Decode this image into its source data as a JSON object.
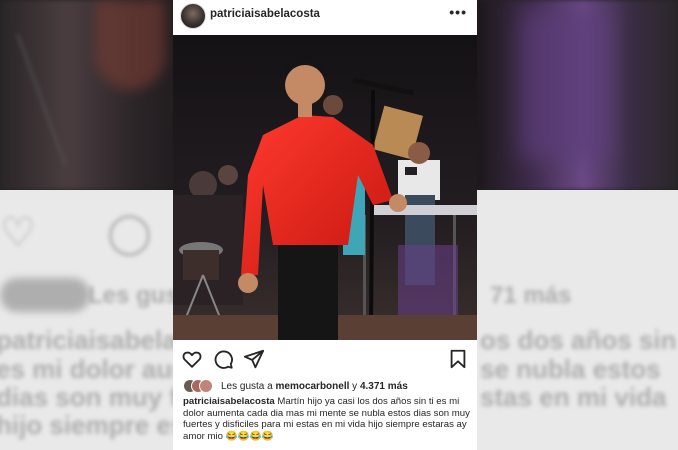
{
  "post": {
    "username": "patriciaisabelacosta",
    "more_label": "•••",
    "likes_prefix": "Les gusta a ",
    "likes_user": "memocarbonell",
    "likes_connector": " y ",
    "likes_count": "4.371 más",
    "caption_user": "patriciaisabelacosta",
    "caption_text": "Martín hijo ya casi los dos años sin ti es mi dolor aumenta cada dia mas mi mente se nubla estos dias son muy fuertes y disficiles para mi estas en mi vida hijo siempre estaras ay amor mio 😂😂😂😂"
  },
  "icons": {
    "like": "heart-icon",
    "comment": "comment-icon",
    "share": "send-icon",
    "save": "bookmark-icon",
    "options": "more-options-icon"
  },
  "background": {
    "ghost_lines": [
      "patriciaisabelacos",
      "es mi dolor aumen",
      "dias son muy fuer",
      "hijo siempre esta"
    ],
    "ghost_right": [
      "os dos años sin",
      "se nubla estos",
      "stas en mi vida"
    ],
    "ghost_likes": "Les gus",
    "ghost_likes_right": "71 más"
  },
  "colors": {
    "text": "#262626",
    "shirt": "#e8241f",
    "card": "#ffffff"
  }
}
